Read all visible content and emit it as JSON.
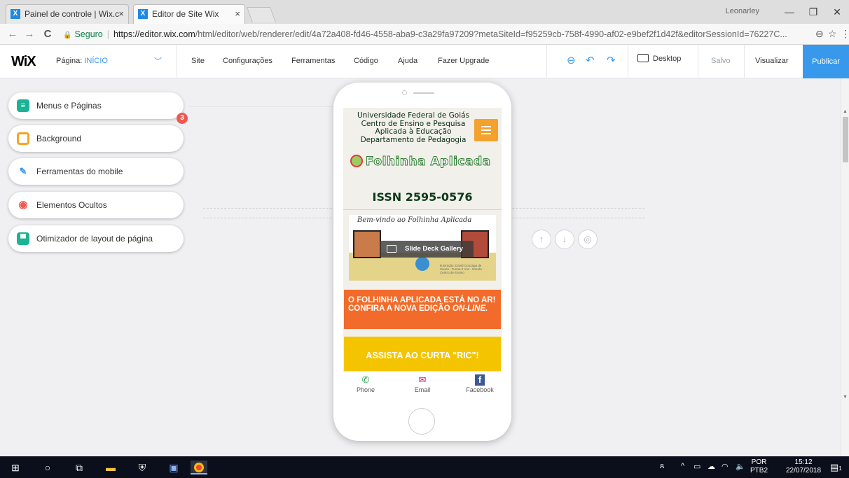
{
  "browser": {
    "tabs": [
      {
        "title": "Painel de controle | Wix.c",
        "close": "×",
        "favicon": "X"
      },
      {
        "title": "Editor de Site Wix",
        "close": "×",
        "favicon": "X"
      }
    ],
    "user": "Leonarley",
    "window_buttons": {
      "minimize": "—",
      "restore": "❐",
      "close": "✕"
    },
    "nav": {
      "back": "←",
      "forward": "→",
      "reload": "C"
    },
    "secure_label": "Seguro",
    "url_host": "https://editor.wix.com",
    "url_rest": "/html/editor/web/renderer/edit/4a72a408-fd46-4558-aba9-c3a29fa97209?metaSiteId=f95259cb-758f-4990-af02-e9bef2f1d42f&editorSessionId=76227C...",
    "zoom_icon": "⊖",
    "star_icon": "☆",
    "menu_icon": "⋮"
  },
  "wix": {
    "logo": "WiX",
    "page_label": "Página:",
    "page_value": "INÍCIO",
    "page_chevron": "﹀",
    "menus": [
      "Site",
      "Configurações",
      "Ferramentas",
      "Código",
      "Ajuda",
      "Fazer Upgrade"
    ],
    "tools": {
      "zoom": "⊖",
      "undo": "↶",
      "redo": "↷"
    },
    "desktop_label": "Desktop",
    "saved_label": "Salvo",
    "preview_label": "Visualizar",
    "publish_label": "Publicar",
    "accent": "#3899ec"
  },
  "panel": {
    "items": [
      {
        "label": "Menus e Páginas",
        "icon": "menus-icon",
        "glyph": "≡",
        "color": "#1bb393"
      },
      {
        "label": "Background",
        "icon": "background-icon",
        "glyph": "",
        "color": "#f6a623"
      },
      {
        "label": "Ferramentas do mobile",
        "icon": "wrench-icon",
        "glyph": "🔧",
        "color": "#3899ec"
      },
      {
        "label": "Elementos Ocultos",
        "icon": "hidden-eye-icon",
        "glyph": "◉",
        "color": "#ee5951"
      },
      {
        "label": "Otimizador de layout de página",
        "icon": "layout-icon",
        "glyph": "▀",
        "color": "#1bb393"
      }
    ],
    "hidden_count": "3"
  },
  "mobile": {
    "header_lines": "Universidade Federal de Goiás\nCentro de Ensino e Pesquisa\nAplicada à Educação\nDepartamento de Pedagogia",
    "logo_text": "Folhinha Aplicada",
    "issn": "ISSN 2595-0576",
    "drawing_caption": "Bem-vindo ao Folhinha Aplicada",
    "drawing_credit": "Ilustração: David Gonzaga de Souza - Turma 2 Ano - Escola Centro de Ensino",
    "gallery_label": "Slide Deck Gallery",
    "news_text": "O FOLHINHA APLICADA ESTÁ NO AR! CONFIRA A NOVA EDIÇÃO",
    "news_em": "ON-LINE.",
    "cta_text": "ASSISTA AO CURTA \"RIC\"!",
    "actions": [
      {
        "label": "Phone",
        "icon": "phone-icon",
        "glyph": "📞",
        "color": "#28a745"
      },
      {
        "label": "Email",
        "icon": "email-icon",
        "glyph": "✉",
        "color": "#c2185b"
      },
      {
        "label": "Facebook",
        "icon": "facebook-icon",
        "glyph": "f",
        "color": "#3b5998"
      }
    ],
    "controls": {
      "up": "↑",
      "down": "↓",
      "hide": "◎"
    }
  },
  "taskbar": {
    "lang_line1": "POR",
    "lang_line2": "PTB2",
    "time": "15:12",
    "date": "22/07/2018",
    "notif_count": "1"
  }
}
